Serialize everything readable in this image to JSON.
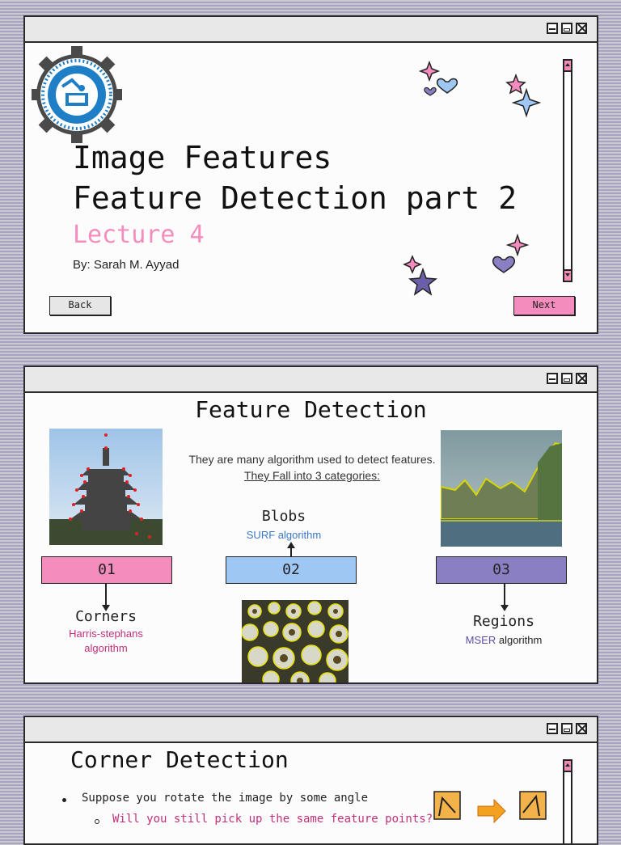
{
  "slide1": {
    "title_line1": "Image Features",
    "title_line2": "Feature Detection part 2",
    "subtitle": "Lecture 4",
    "author": "By: Sarah M. Ayyad",
    "back_label": "Back",
    "next_label": "Next"
  },
  "slide2": {
    "title": "Feature Detection",
    "intro_line1": "They are many algorithm used to detect features.",
    "intro_line2": "They Fall into 3 categories:",
    "blobs_title": "Blobs",
    "blobs_algo": "SURF algorithm",
    "cat1": "01",
    "cat2": "02",
    "cat3": "03",
    "corners_title": "Corners",
    "corners_algo_line1": "Harris-stephans",
    "corners_algo_line2": "algorithm",
    "regions_title": "Regions",
    "regions_algo_a": "MSER",
    "regions_algo_b": " algorithm"
  },
  "slide3": {
    "title": "Corner Detection",
    "bullet1": "Suppose you rotate the image by some angle",
    "sub_bullet1": "Will you still pick up the same feature points?"
  },
  "colors": {
    "pink": "#f48cbd",
    "blue": "#9ec7f4",
    "purple": "#8b7fc3",
    "magenta": "#c0307a",
    "link_blue": "#3a78c9",
    "mser_purple": "#5a4fa0"
  }
}
